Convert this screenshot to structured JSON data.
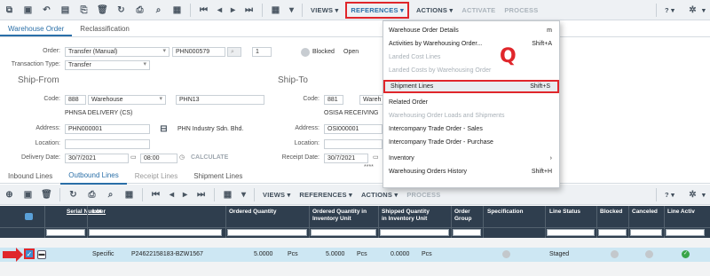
{
  "toolbar": {
    "views": "VIEWS",
    "references": "REFERENCES",
    "actions": "ACTIONS",
    "activate": "ACTIVATE",
    "process": "PROCESS",
    "help": "?"
  },
  "tabs": {
    "warehouse_order": "Warehouse Order",
    "reclassification": "Reclassification"
  },
  "header": {
    "order_label": "Order:",
    "order_type": "Transfer (Manual)",
    "order_no": "PHN000579",
    "order_seq": "1",
    "blocked_label": "Blocked",
    "status": "Open",
    "transaction_type_label": "Transaction Type:",
    "transaction_type": "Transfer"
  },
  "ship_from": {
    "title": "Ship-From",
    "code_label": "Code:",
    "code": "888",
    "type": "Warehouse",
    "warehouse": "PHN13",
    "desc": "PHNSA DELIVERY (CS)",
    "address_label": "Address:",
    "address": "PHN000001",
    "company": "PHN Industry Sdn. Bhd.",
    "location_label": "Location:",
    "delivery_label": "Delivery Date:",
    "delivery_date": "30/7/2021",
    "delivery_time": "08:00",
    "calculate": "CALCULATE"
  },
  "ship_to": {
    "title": "Ship-To",
    "code_label": "Code:",
    "code": "881",
    "type": "Wareh",
    "desc": "OSISA RECEIVING",
    "address_label": "Address:",
    "address": "OSI000001",
    "location_label": "Location:",
    "receipt_label": "Receipt Date:",
    "receipt_date": "30/7/2021",
    "stars": "****"
  },
  "references_menu": {
    "items": [
      {
        "label": "Warehouse Order Details",
        "shortcut": "m",
        "state": "normal"
      },
      {
        "label": "Activities by Warehousing Order...",
        "shortcut": "Shift+A",
        "state": "normal"
      },
      {
        "label": "Landed Cost Lines",
        "shortcut": "",
        "state": "disabled"
      },
      {
        "label": "Landed Costs by Warehousing Order",
        "shortcut": "",
        "state": "disabled"
      },
      {
        "label": "Shipment Lines",
        "shortcut": "Shift+S",
        "state": "highlighted"
      },
      {
        "label": "Related Order",
        "shortcut": "",
        "state": "normal"
      },
      {
        "label": "Warehousing Order Loads and Shipments",
        "shortcut": "",
        "state": "disabled"
      },
      {
        "label": "Intercompany Trade Order - Sales",
        "shortcut": "",
        "state": "normal"
      },
      {
        "label": "Intercompany Trade Order - Purchase",
        "shortcut": "",
        "state": "normal"
      },
      {
        "label": "Inventory",
        "shortcut": "›",
        "state": "normal"
      },
      {
        "label": "Warehousing Orders History",
        "shortcut": "Shift+H",
        "state": "normal"
      }
    ]
  },
  "annotation": {
    "q": "Q"
  },
  "lines_tabs": {
    "inbound": "Inbound Lines",
    "outbound": "Outbound Lines",
    "receipt": "Receipt Lines",
    "shipment": "Shipment Lines"
  },
  "grid": {
    "headers": {
      "serial": "Serial Number",
      "lot": "Lot",
      "ordered_qty": "Ordered Quantity",
      "ordered_qty_inv": "Ordered Quantity in Inventory Unit",
      "shipped_qty": "Shipped Quantity in Inventory Unit",
      "order_group": "Order Group",
      "specification": "Specification",
      "line_status": "Line Status",
      "blocked": "Blocked",
      "canceled": "Canceled",
      "line_active": "Line Activ"
    },
    "row": {
      "serial": "Specific",
      "lot": "P24622158183-BZW1567",
      "ordered_qty": "5.0000",
      "ordered_unit": "Pcs",
      "ordered_inv_qty": "5.0000",
      "ordered_inv_unit": "Pcs",
      "shipped_qty": "0.0000",
      "shipped_unit": "Pcs",
      "line_status": "Staged"
    }
  },
  "colors": {
    "accent": "#2a6fa8",
    "highlight_red": "#e0262b",
    "grid_header": "#2f3e4e",
    "selected_row": "#cde7f3"
  }
}
